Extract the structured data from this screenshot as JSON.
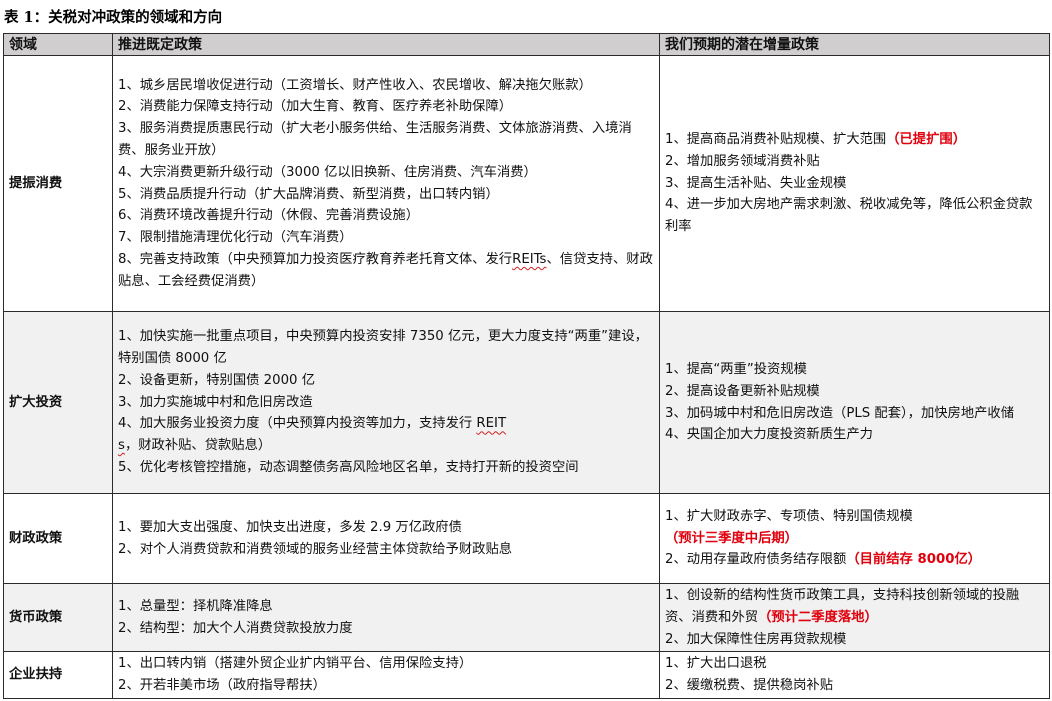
{
  "caption": "表 1：关税对冲政策的领域和方向",
  "headers": [
    "领域",
    "推进既定政策",
    "我们预期的潜在增量政策"
  ],
  "rows": [
    {
      "domain": "提振消费",
      "shaded": false,
      "existing": [
        "1、城乡居民增收促进行动（工资增长、财产性收入、农民增收、解决拖欠账款）",
        "2、消费能力保障支持行动（加大生育、教育、医疗养老补助保障）",
        "3、服务消费提质惠民行动（扩大老小服务供给、生活服务消费、文体旅游消费、入境消费、服务业开放）",
        "4、大宗消费更新升级行动（3000 亿以旧换新、住房消费、汽车消费）",
        "5、消费品质提升行动（扩大品牌消费、新型消费，出口转内销）",
        "6、消费环境改善提升行动（休假、完善消费设施）",
        "7、限制措施清理优化行动（汽车消费）",
        "8、完善支持政策（中央预算加力投资医疗教育养老托育文体、发行REITs、信贷支持、财政贴息、工会经费促消费）"
      ],
      "potential": [
        {
          "text": "1、提高商品消费补贴规模、扩大范围",
          "note": "（已提扩围）"
        },
        {
          "text": "2、增加服务领域消费补贴",
          "note": ""
        },
        {
          "text": "3、提高生活补贴、失业金规模",
          "note": ""
        },
        {
          "text": "4、进一步加大房地产需求刺激、税收减免等，降低公积金贷款利率",
          "note": ""
        }
      ]
    },
    {
      "domain": "扩大投资",
      "shaded": true,
      "existing": [
        "1、加快实施一批重点项目，中央预算内投资安排 7350 亿元，更大力度支持“两重”建设，特别国债 8000 亿",
        "2、设备更新，特别国债 2000 亿",
        "3、加力实施城中村和危旧房改造",
        "4、加大服务业投资力度（中央预算内投资等加力，支持发行 REITs，财政补贴、贷款贴息）",
        "5、优化考核管控措施，动态调整债务高风险地区名单，支持打开新的投资空间"
      ],
      "potential": [
        {
          "text": "1、提高“两重”投资规模",
          "note": ""
        },
        {
          "text": "2、提高设备更新补贴规模",
          "note": ""
        },
        {
          "text": "3、加码城中村和危旧房改造（PLS 配套），加快房地产收储",
          "note": ""
        },
        {
          "text": "4、央国企加大力度投资新质生产力",
          "note": ""
        }
      ]
    },
    {
      "domain": "财政政策",
      "shaded": false,
      "existing": [
        "1、要加大支出强度、加快支出进度，多发 2.9 万亿政府债",
        "2、对个人消费贷款和消费领域的服务业经营主体贷款给予财政贴息"
      ],
      "potential": [
        {
          "text": "1、扩大财政赤字、专项债、特别国债规模",
          "note": "（预计三季度中后期）"
        },
        {
          "text": "2、动用存量政府债务结存限额",
          "note": "（目前结存 8000亿）"
        }
      ]
    },
    {
      "domain": "货币政策",
      "shaded": true,
      "existing": [
        "1、总量型：择机降准降息",
        "2、结构型：加大个人消费贷款投放力度"
      ],
      "potential": [
        {
          "text": "1、创设新的结构性货币政策工具，支持科技创新领域的投融资、消费和外贸",
          "note": "（预计二季度落地）"
        },
        {
          "text": "2、加大保障性住房再贷款规模",
          "note": ""
        }
      ]
    },
    {
      "domain": "企业扶持",
      "shaded": false,
      "existing": [
        "1、出口转内销（搭建外贸企业扩内销平台、信用保险支持）",
        "2、开若非美市场（政府指导帮扶）"
      ],
      "potential": [
        {
          "text": "1、扩大出口退税",
          "note": ""
        },
        {
          "text": "2、缓缴税费、提供稳岗补贴",
          "note": ""
        }
      ]
    }
  ]
}
